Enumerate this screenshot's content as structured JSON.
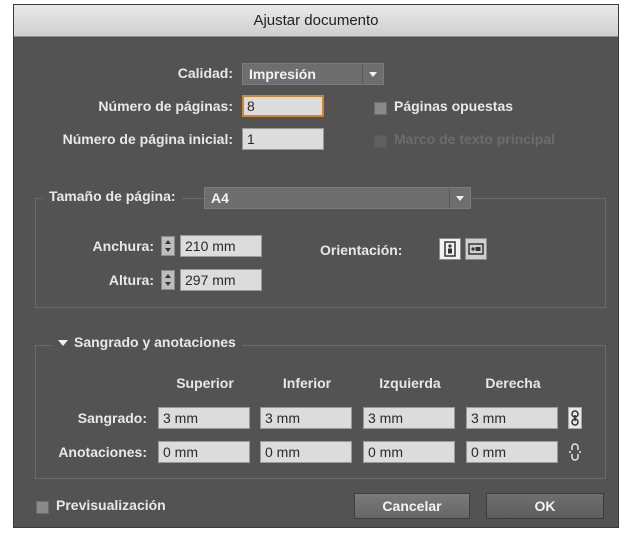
{
  "dialog": {
    "title": "Ajustar documento"
  },
  "top": {
    "quality_label": "Calidad:",
    "quality_value": "Impresión",
    "num_pages_label": "Número de páginas:",
    "num_pages_value": "8",
    "start_page_label": "Número de página inicial:",
    "start_page_value": "1",
    "facing_pages_label": "Páginas opuestas",
    "master_text_label": "Marco de texto principal"
  },
  "page_size": {
    "label": "Tamaño de página:",
    "value": "A4",
    "width_label": "Anchura:",
    "width_value": "210 mm",
    "height_label": "Altura:",
    "height_value": "297 mm",
    "orientation_label": "Orientación:",
    "orientation_selected": "portrait"
  },
  "bleed": {
    "section_label": "Sangrado y anotaciones",
    "columns": [
      "Superior",
      "Inferior",
      "Izquierda",
      "Derecha"
    ],
    "bleed_label": "Sangrado:",
    "bleed_values": [
      "3 mm",
      "3 mm",
      "3 mm",
      "3 mm"
    ],
    "slug_label": "Anotaciones:",
    "slug_values": [
      "0 mm",
      "0 mm",
      "0 mm",
      "0 mm"
    ]
  },
  "footer": {
    "preview_label": "Previsualización",
    "cancel_label": "Cancelar",
    "ok_label": "OK"
  },
  "colors": {
    "dialog_bg": "#535353",
    "focus_ring": "#d4832f",
    "title_bar": "#dcdcdc"
  }
}
